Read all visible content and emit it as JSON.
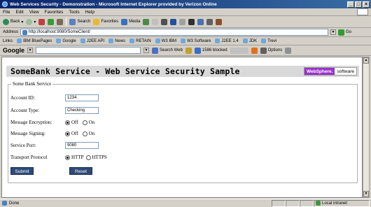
{
  "window": {
    "title": "Web Services Security - Demonstration - Microsoft Internet Explorer provided by Verizon Online"
  },
  "menu": [
    "File",
    "Edit",
    "View",
    "Favorites",
    "Tools",
    "Help"
  ],
  "toolbar": {
    "back": "Back",
    "search": "Search",
    "favorites": "Favorites",
    "media": "Media"
  },
  "address": {
    "label": "Address",
    "url": "http://localhost:9080/SomeClient/",
    "go": "Go"
  },
  "links": {
    "label": "Links",
    "items": [
      "IBM BluePages",
      "Google",
      "J2EE API",
      "News",
      "RETAIN",
      "W3 IBM",
      "W3 Software",
      "J2EE 1.4",
      "JDK",
      "Trevi"
    ]
  },
  "googlebar": {
    "logo": "Google",
    "search_web": "Search Web",
    "blocked": "1586 blocked",
    "options": "Options"
  },
  "page": {
    "title": "SomeBank Service - Web Service Security Sample",
    "logo_brand": "WebSphere.",
    "logo_software": "software",
    "legend": "Some Bank Service",
    "account_id_label": "Account ID:",
    "account_id_value": "1234",
    "account_type_label": "Account Type:",
    "account_type_value": "Checking",
    "encryption_label": "Message Encryption:",
    "signing_label": "Message Signing:",
    "off": "Off",
    "on": "On",
    "port_label": "Service Port:",
    "port_value": "9080",
    "transport_label": "Transport Protocol",
    "http": "HTTP",
    "https": "HTTPS",
    "submit": "Submit",
    "reset": "Reset"
  },
  "status": {
    "text": "Done",
    "zone": "Local intranet"
  }
}
